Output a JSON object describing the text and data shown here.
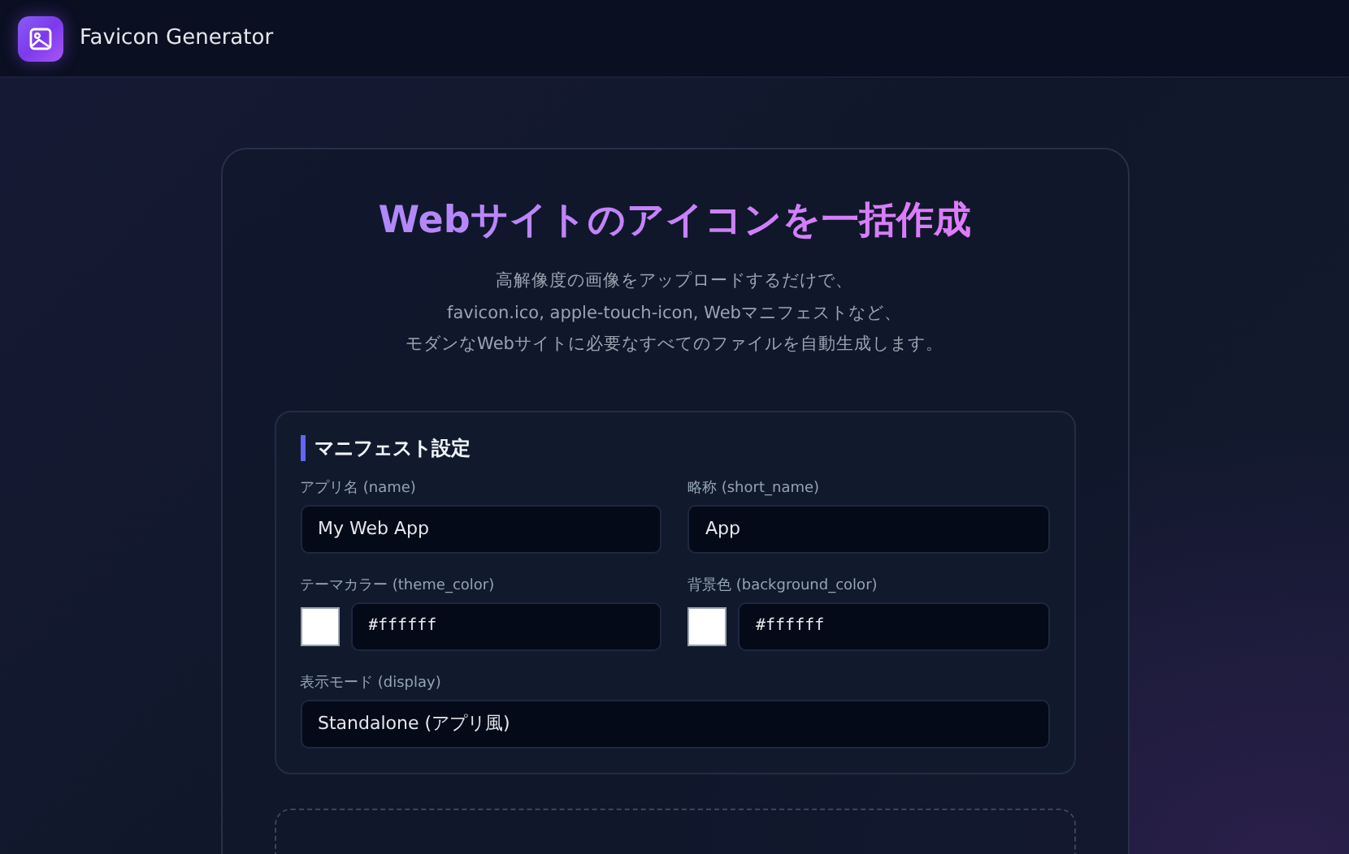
{
  "header": {
    "app_name": "Favicon Generator"
  },
  "hero": {
    "title": "Webサイトのアイコンを一括作成",
    "subtitle_lines": [
      "高解像度の画像をアップロードするだけで、",
      "favicon.ico, apple-touch-icon, Webマニフェストなど、",
      "モダンなWebサイトに必要なすべてのファイルを自動生成します。"
    ]
  },
  "manifest_settings": {
    "heading": "マニフェスト設定",
    "fields": [
      {
        "kind": "text",
        "label": "アプリ名 (name)",
        "value": "My Web App"
      },
      {
        "kind": "text",
        "label": "略称 (short_name)",
        "value": "App"
      },
      {
        "kind": "color",
        "label": "テーマカラー (theme_color)",
        "value": "#ffffff",
        "color": "#ffffff"
      },
      {
        "kind": "color",
        "label": "背景色 (background_color)",
        "value": "#ffffff",
        "color": "#ffffff"
      },
      {
        "kind": "select",
        "label": "表示モード (display)",
        "value": "Standalone (アプリ風)"
      }
    ]
  }
}
